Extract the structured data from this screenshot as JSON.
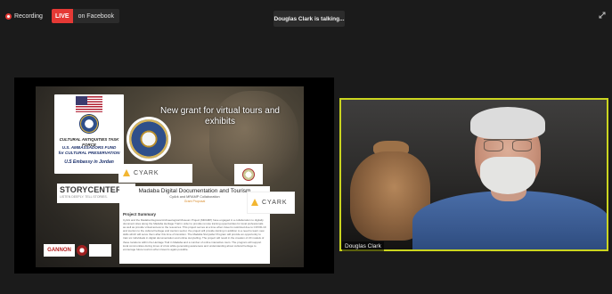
{
  "top_bar": {
    "recording_label": "Recording",
    "live_badge": "LIVE",
    "live_platform": "on Facebook",
    "talking_indicator": "Douglas Clark is talking..."
  },
  "slide": {
    "title": "New grant for virtual tours and exhibits",
    "usa_card": {
      "line1": "CULTURAL ANTIQUITIES TASK FORCE",
      "line2": "U.S. AMBASSADORS FUND",
      "line3": "for CULTURAL PRESERVATION",
      "line4": "U.S Embassy in Jordan"
    },
    "cyark_logo_text": "CYARK",
    "storycenter": {
      "name": "STORYCENTER",
      "tagline": "LISTEN DEEPLY. TELL STORIES."
    },
    "summary": {
      "title": "Madaba Digital Documentation and Tourism",
      "subtitle": "CyArk and MRAMP Collaboration",
      "status": "Grant Proposal",
      "heading": "Project Summary",
      "body": "CyArk and the Madaba Regional Archaeological Museum Project (MRAMP) have engaged in a collaboration to digitally document sites along the Madaba Heritage Trail in order to provide remote training opportunities for local professionals as well as provide virtual access to the resources. This project serves at a time when travel is restricted due to COVID-19 and tourism to the cultural heritage and tourism sector, the project will provide training in addition to a need to learn new skills which will serve them after this time of transition. The Madaba Storyteller Program will provide an opportunity to train six individuals in digital documentation and online storytelling. The project will result in the creation of 20 models of these locations within the Heritage Trail in Madaba and a number of online interactive tours. The program will support local communities during times of crisis while generating awareness and understanding about cultural heritage to encourage future tourism when travel is again possible."
    },
    "gannon_logo": "GANNON"
  },
  "video": {
    "participant_name": "Douglas Clark"
  },
  "icons": {
    "recording": "recording-dot-icon",
    "fullscreen": "fullscreen-icon"
  },
  "colors": {
    "live_red": "#e53935",
    "active_speaker_border": "#cbd51f",
    "cyark_gold": "#f2b632"
  }
}
